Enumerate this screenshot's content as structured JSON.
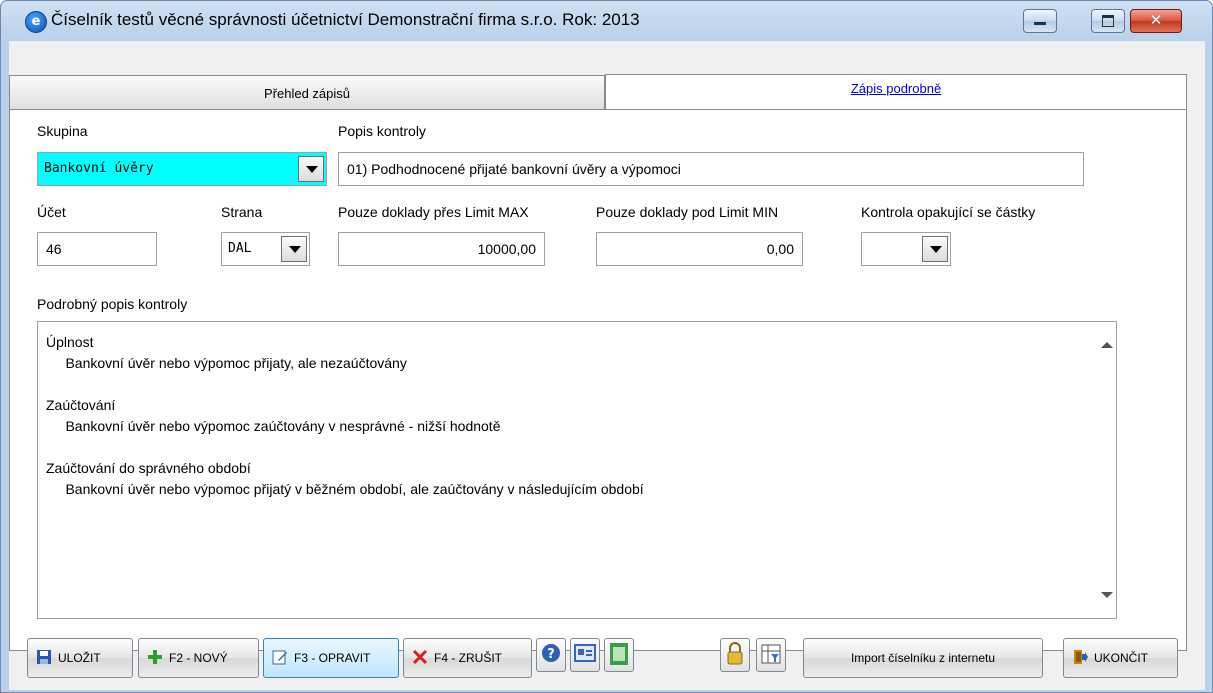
{
  "window": {
    "title": "Číselník testů věcné správnosti účetnictví  Demonstrační firma s.r.o.  Rok: 2013"
  },
  "tabs": [
    {
      "label": "Přehled zápisů"
    },
    {
      "label": "Zápis podrobně"
    }
  ],
  "form": {
    "skupina_label": "Skupina",
    "skupina_value": "Bankovní úvěry",
    "popis_label": "Popis kontroly",
    "popis_value": "01) Podhodnocené přijaté bankovní úvěry a výpomoci",
    "ucet_label": "Účet",
    "ucet_value": "46",
    "strana_label": "Strana",
    "strana_value": "DAL",
    "limit_max_label": "Pouze doklady přes Limit MAX",
    "limit_max_value": "10000,00",
    "limit_min_label": "Pouze doklady pod Limit MIN",
    "limit_min_value": "0,00",
    "opakujici_label": "Kontrola opakující se částky",
    "opakujici_value": "",
    "detail_label": "Podrobný popis kontroly",
    "detail_value": "Úplnost\n     Bankovní úvěr nebo výpomoc přijaty, ale nezaúčtovány\n\nZaúčtování\n     Bankovní úvěr nebo výpomoc zaúčtovány v nesprávné - nižší hodnotě\n\nZaúčtování do správného období\n     Bankovní úvěr nebo výpomoc přijatý v běžném období, ale zaúčtovány v následujícím období"
  },
  "toolbar": {
    "save": "ULOŽIT",
    "new": "F2 - NOVÝ",
    "edit": "F3 - OPRAVIT",
    "delete": "F4 - ZRUŠIT",
    "import": "Import číselníku z internetu",
    "exit": "UKONČIT"
  },
  "colors": {
    "selected_combo": "#00ffff",
    "accent_link": "#0000ee"
  }
}
